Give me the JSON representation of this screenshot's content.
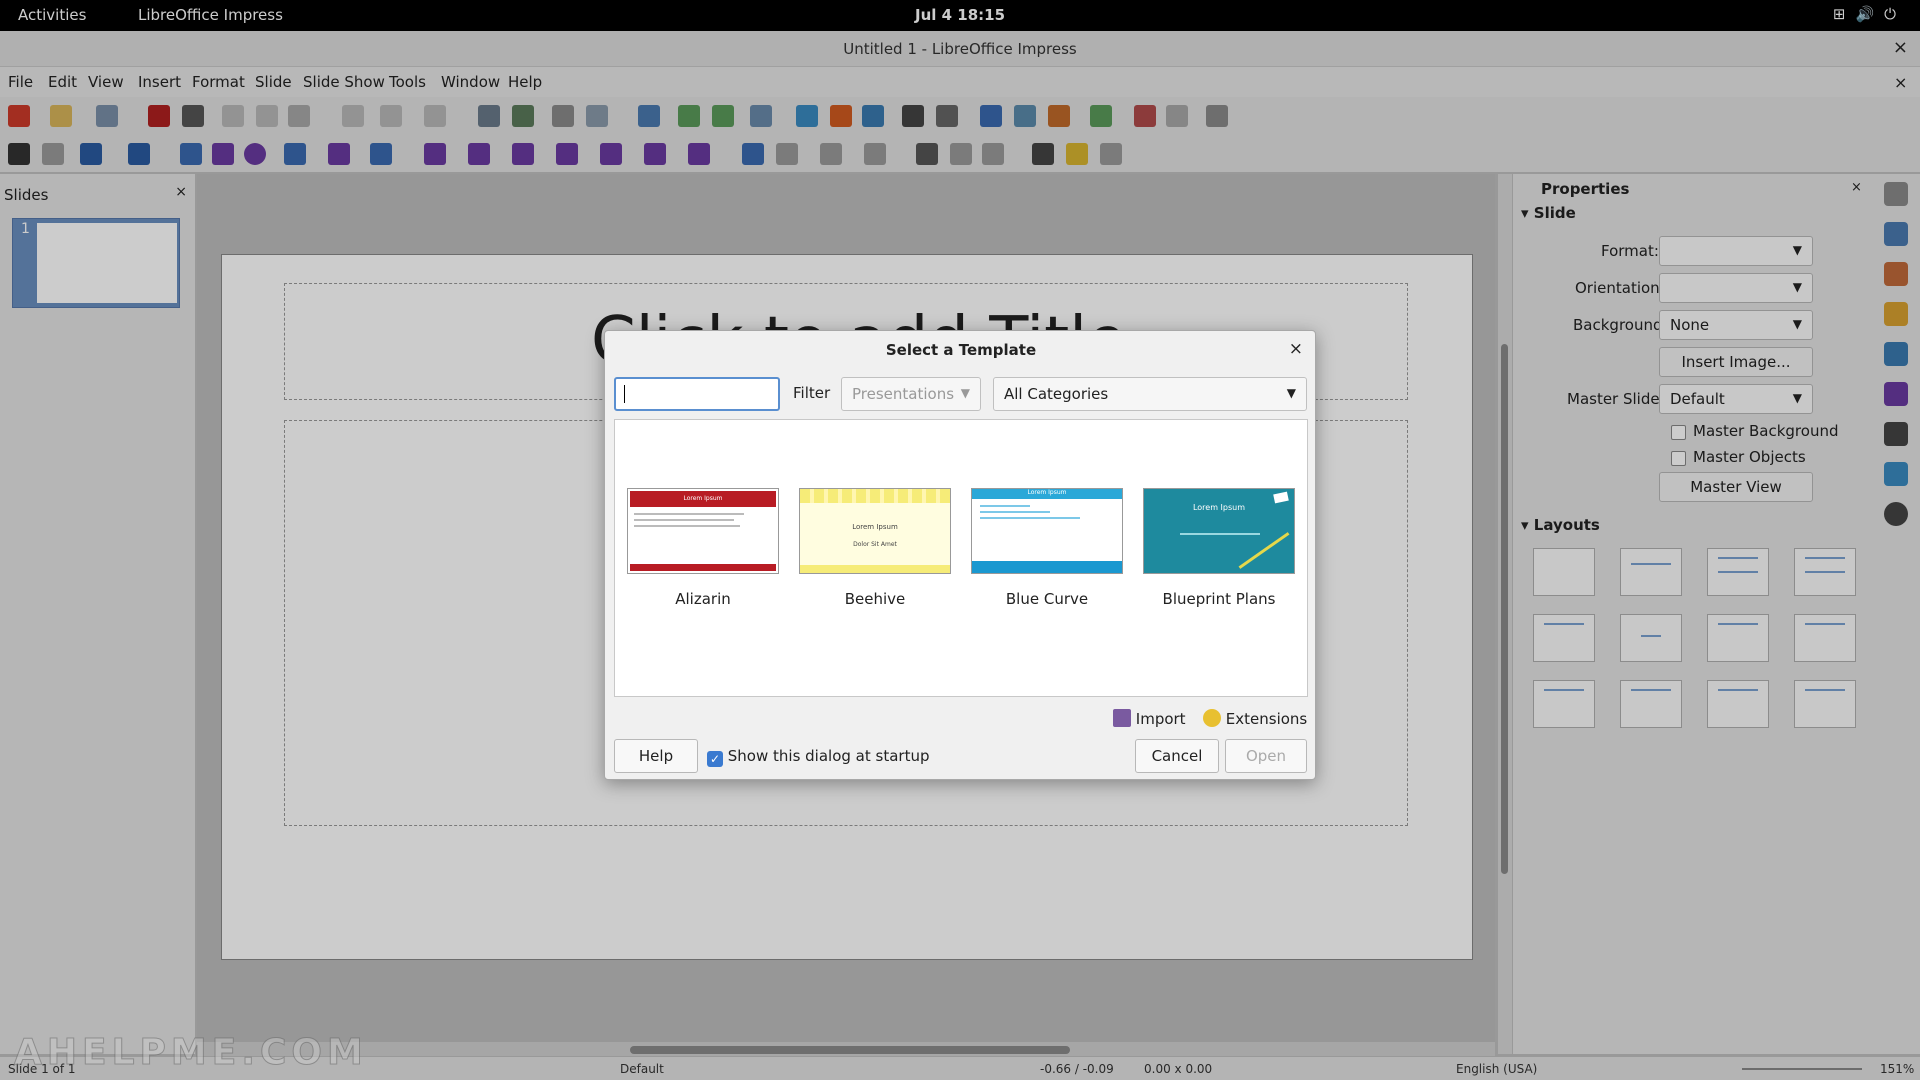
{
  "topbar": {
    "activities": "Activities",
    "app_name": "LibreOffice Impress",
    "clock": "Jul 4  18:15"
  },
  "window": {
    "title": "Untitled 1 - LibreOffice Impress"
  },
  "menu": [
    "File",
    "Edit",
    "View",
    "Insert",
    "Format",
    "Slide",
    "Slide Show",
    "Tools",
    "Window",
    "Help"
  ],
  "slides_pane": {
    "title": "Slides",
    "close": "×",
    "slide_number": "1"
  },
  "slide": {
    "title_placeholder": "Click to add Title"
  },
  "properties": {
    "title": "Properties",
    "section_slide": "Slide",
    "format_label": "Format:",
    "format_value": "",
    "orientation_label": "Orientation:",
    "orientation_value": "",
    "background_label": "Background:",
    "background_value": "None",
    "insert_image": "Insert Image...",
    "master_slide_label": "Master Slide:",
    "master_slide_value": "Default",
    "master_background": "Master Background",
    "master_objects": "Master Objects",
    "master_view": "Master View",
    "section_layouts": "Layouts"
  },
  "dialog": {
    "title": "Select a Template",
    "search_value": "",
    "filter_label": "Filter",
    "filter_value": "Presentations",
    "category_value": "All Categories",
    "templates": [
      {
        "name": "Alizarin",
        "preview_heading": "Lorem Ipsum"
      },
      {
        "name": "Beehive",
        "preview_line1": "Lorem Ipsum",
        "preview_line2": "Dolor Sit Amet"
      },
      {
        "name": "Blue Curve",
        "preview_heading": "Lorem Ipsum"
      },
      {
        "name": "Blueprint Plans",
        "preview_heading": "Lorem Ipsum"
      }
    ],
    "import_label": "Import",
    "extensions_label": "Extensions",
    "help_label": "Help",
    "show_at_startup": "Show this dialog at startup",
    "show_at_startup_checked": true,
    "cancel_label": "Cancel",
    "open_label": "Open"
  },
  "statusbar": {
    "slide_count": "Slide 1 of 1",
    "master": "Default",
    "position": "-0.66 / -0.09",
    "size": "0.00 x 0.00",
    "language": "English (USA)",
    "zoom": "151%"
  },
  "watermark": "AHELPME.COM"
}
